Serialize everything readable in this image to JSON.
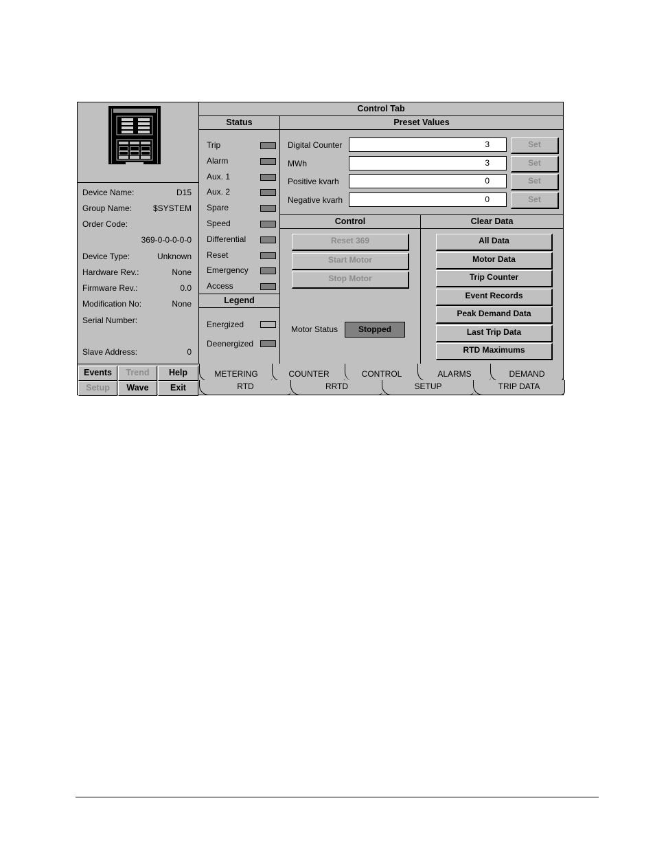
{
  "window_title": "Control Tab",
  "device_info": {
    "fields": [
      {
        "label": "Device Name:",
        "value": "D15"
      },
      {
        "label": "Group Name:",
        "value": "$SYSTEM"
      },
      {
        "label": "Order Code:",
        "value": ""
      },
      {
        "label": "",
        "value": "369-0-0-0-0-0"
      },
      {
        "label": "Device Type:",
        "value": "Unknown"
      },
      {
        "label": "Hardware Rev.:",
        "value": "None"
      },
      {
        "label": "Firmware Rev.:",
        "value": "0.0"
      },
      {
        "label": "Modification No:",
        "value": "None"
      },
      {
        "label": "Serial Number:",
        "value": ""
      },
      {
        "label": "Slave Address:",
        "value": "0"
      }
    ]
  },
  "nav_buttons": [
    {
      "label": "Events",
      "enabled": true
    },
    {
      "label": "Trend",
      "enabled": false
    },
    {
      "label": "Help",
      "enabled": true
    },
    {
      "label": "Setup",
      "enabled": false
    },
    {
      "label": "Wave",
      "enabled": true
    },
    {
      "label": "Exit",
      "enabled": true
    }
  ],
  "status": {
    "title": "Status",
    "items": [
      {
        "label": "Trip",
        "state": "deenergized"
      },
      {
        "label": "Alarm",
        "state": "deenergized"
      },
      {
        "label": "Aux. 1",
        "state": "deenergized"
      },
      {
        "label": "Aux. 2",
        "state": "deenergized"
      },
      {
        "label": "Spare",
        "state": "deenergized"
      },
      {
        "label": "Speed",
        "state": "deenergized"
      },
      {
        "label": "Differential",
        "state": "deenergized"
      },
      {
        "label": "Reset",
        "state": "deenergized"
      },
      {
        "label": "Emergency",
        "state": "deenergized"
      },
      {
        "label": "Access",
        "state": "deenergized"
      }
    ]
  },
  "legend": {
    "title": "Legend",
    "items": [
      {
        "label": "Energized",
        "color": "#b8b8b8"
      },
      {
        "label": "Deenergized",
        "color": "#808080"
      }
    ]
  },
  "preset_values": {
    "title": "Preset Values",
    "rows": [
      {
        "label": "Digital Counter",
        "value": "3",
        "button": "Set"
      },
      {
        "label": "MWh",
        "value": "3",
        "button": "Set"
      },
      {
        "label": "Positive kvarh",
        "value": "0",
        "button": "Set"
      },
      {
        "label": "Negative kvarh",
        "value": "0",
        "button": "Set"
      }
    ]
  },
  "control": {
    "title": "Control",
    "buttons": [
      "Reset 369",
      "Start Motor",
      "Stop Motor"
    ],
    "motor_status_label": "Motor Status",
    "motor_status_value": "Stopped"
  },
  "clear_data": {
    "title": "Clear Data",
    "buttons": [
      "All Data",
      "Motor Data",
      "Trip Counter",
      "Event Records",
      "Peak Demand Data",
      "Last Trip Data",
      "RTD Maximums"
    ]
  },
  "tabs": {
    "row1": [
      "METERING",
      "COUNTER",
      "CONTROL",
      "ALARMS",
      "DEMAND"
    ],
    "row2": [
      "RTD",
      "RRTD",
      "SETUP",
      "TRIP DATA"
    ],
    "active": "CONTROL"
  }
}
